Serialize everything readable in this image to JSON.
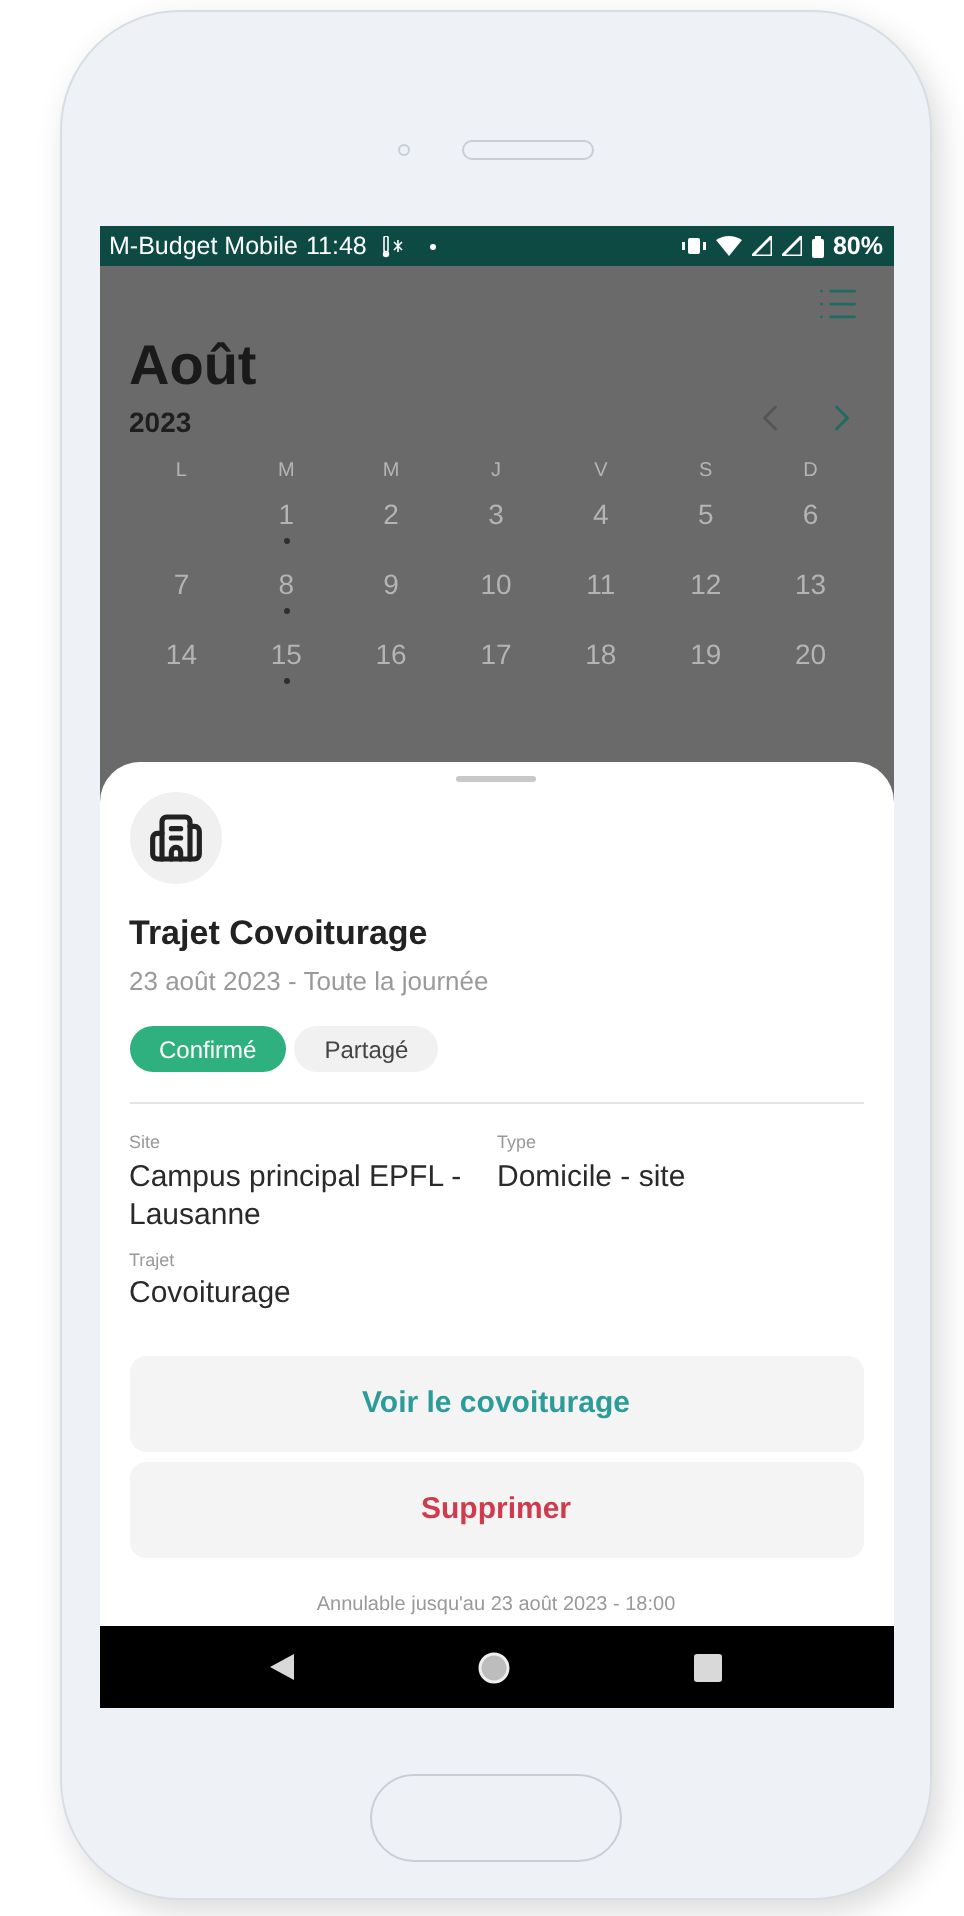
{
  "status_bar": {
    "carrier": "M-Budget Mobile",
    "time": "11:48",
    "battery": "80%"
  },
  "calendar": {
    "month": "Août",
    "year": "2023",
    "weekdays": [
      "L",
      "M",
      "M",
      "J",
      "V",
      "S",
      "D"
    ],
    "weeks": [
      [
        {
          "day": "1",
          "dot": true
        },
        {
          "day": "2",
          "dot": false
        },
        {
          "day": "3",
          "dot": false
        },
        {
          "day": "4",
          "dot": false
        },
        {
          "day": "5",
          "dot": false
        },
        {
          "day": "6",
          "dot": false
        }
      ],
      [
        {
          "day": "7",
          "dot": false
        },
        {
          "day": "8",
          "dot": true
        },
        {
          "day": "9",
          "dot": false
        },
        {
          "day": "10",
          "dot": false
        },
        {
          "day": "11",
          "dot": false
        },
        {
          "day": "12",
          "dot": false
        },
        {
          "day": "13",
          "dot": false
        }
      ],
      [
        {
          "day": "14",
          "dot": false
        },
        {
          "day": "15",
          "dot": true
        },
        {
          "day": "16",
          "dot": false
        },
        {
          "day": "17",
          "dot": false
        },
        {
          "day": "18",
          "dot": false
        },
        {
          "day": "19",
          "dot": false
        },
        {
          "day": "20",
          "dot": false
        }
      ]
    ]
  },
  "sheet": {
    "title": "Trajet Covoiturage",
    "subtitle": "23 août 2023 - Toute la journée",
    "tags": [
      {
        "label": "Confirmé",
        "kind": "status"
      },
      {
        "label": "Partagé",
        "kind": "plain"
      }
    ],
    "fields": [
      {
        "label": "Site",
        "value": "Campus principal EPFL - Lausanne"
      },
      {
        "label": "Type",
        "value": "Domicile - site"
      },
      {
        "label": "Trajet",
        "value": "Covoiturage"
      }
    ],
    "buttons": [
      {
        "label": "Voir le covoiturage",
        "kind": "primary"
      },
      {
        "label": "Supprimer",
        "kind": "danger"
      }
    ],
    "footer": "Annulable jusqu'au 23 août 2023 - 18:00"
  }
}
